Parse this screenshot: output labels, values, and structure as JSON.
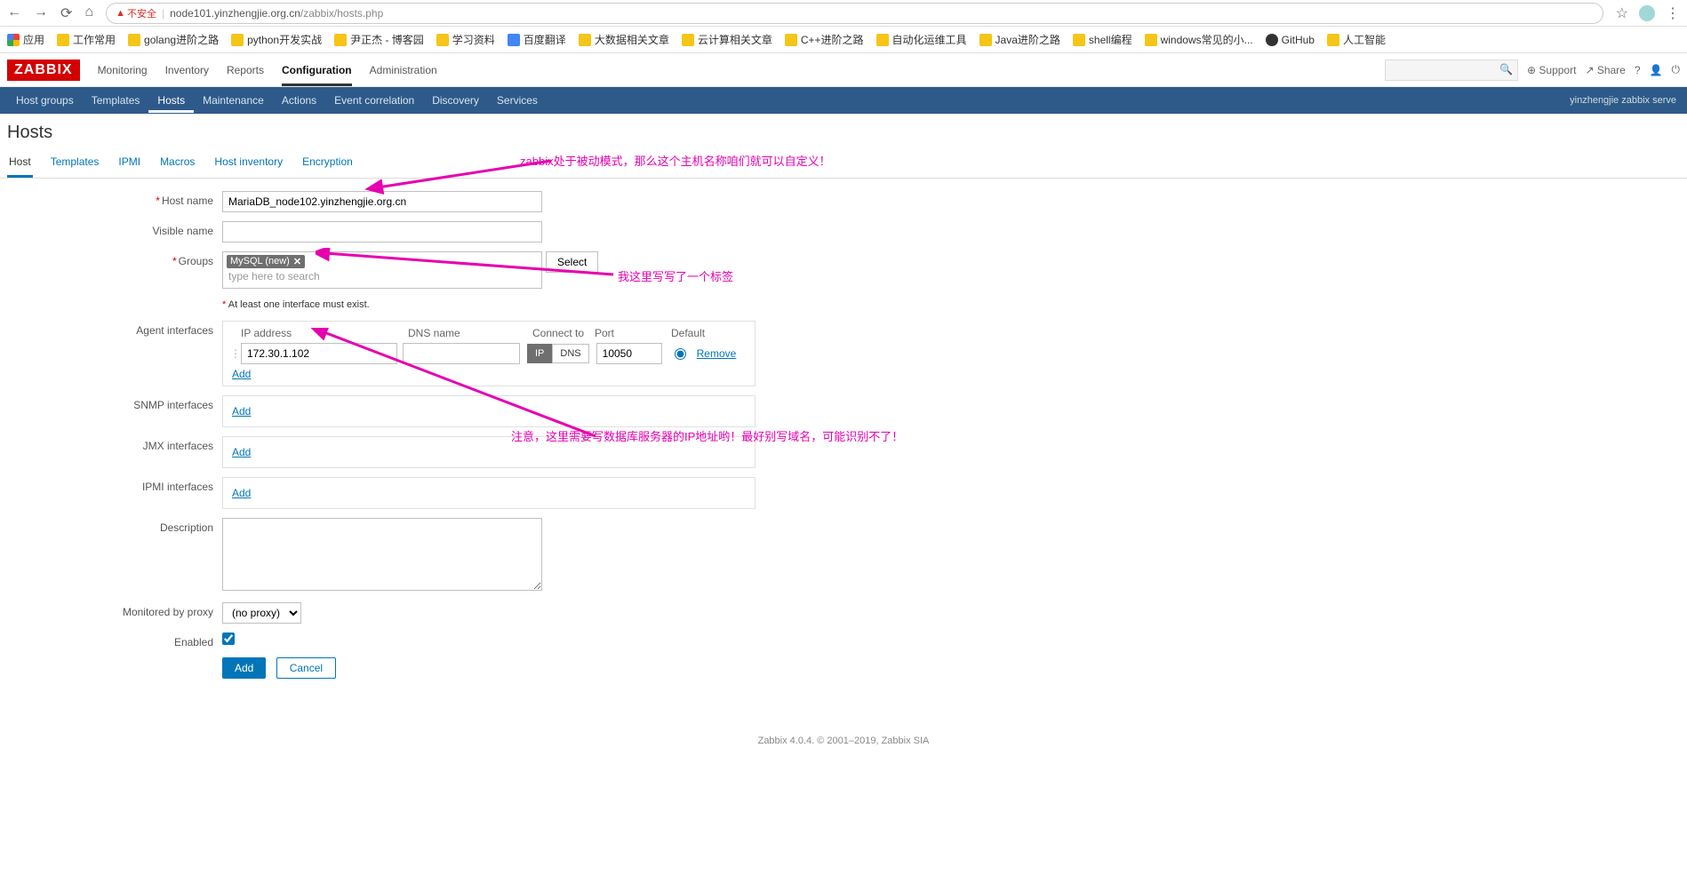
{
  "browser": {
    "url_warn": "不安全",
    "url_host": "node101.yinzhengjie.org.cn",
    "url_path": "/zabbix/hosts.php",
    "apps_label": "应用",
    "bookmarks": [
      {
        "label": "工作常用",
        "icon": "y"
      },
      {
        "label": "golang进阶之路",
        "icon": "y"
      },
      {
        "label": "python开发实战",
        "icon": "y"
      },
      {
        "label": "尹正杰 - 博客园",
        "icon": "y"
      },
      {
        "label": "学习资料",
        "icon": "y"
      },
      {
        "label": "百度翻译",
        "icon": "b"
      },
      {
        "label": "大数据相关文章",
        "icon": "y"
      },
      {
        "label": "云计算相关文章",
        "icon": "y"
      },
      {
        "label": "C++进阶之路",
        "icon": "y"
      },
      {
        "label": "自动化运维工具",
        "icon": "y"
      },
      {
        "label": "Java进阶之路",
        "icon": "y"
      },
      {
        "label": "shell编程",
        "icon": "y"
      },
      {
        "label": "windows常见的小...",
        "icon": "y"
      },
      {
        "label": "GitHub",
        "icon": "gh"
      },
      {
        "label": "人工智能",
        "icon": "y"
      }
    ]
  },
  "header": {
    "logo": "ZABBIX",
    "menu": [
      "Monitoring",
      "Inventory",
      "Reports",
      "Configuration",
      "Administration"
    ],
    "active_menu": "Configuration",
    "support": "Support",
    "share": "Share"
  },
  "subnav": {
    "items": [
      "Host groups",
      "Templates",
      "Hosts",
      "Maintenance",
      "Actions",
      "Event correlation",
      "Discovery",
      "Services"
    ],
    "active": "Hosts",
    "right": "yinzhengjie zabbix serve"
  },
  "page": {
    "title": "Hosts",
    "tabs": [
      "Host",
      "Templates",
      "IPMI",
      "Macros",
      "Host inventory",
      "Encryption"
    ],
    "active_tab": "Host"
  },
  "labels": {
    "host_name": "Host name",
    "visible_name": "Visible name",
    "groups": "Groups",
    "groups_placeholder": "type here to search",
    "select": "Select",
    "at_least_one": "At least one interface must exist.",
    "agent_interfaces": "Agent interfaces",
    "snmp_interfaces": "SNMP interfaces",
    "jmx_interfaces": "JMX interfaces",
    "ipmi_interfaces": "IPMI interfaces",
    "description": "Description",
    "monitored_by_proxy": "Monitored by proxy",
    "enabled": "Enabled",
    "add_btn": "Add",
    "cancel_btn": "Cancel",
    "add_link": "Add",
    "ip_address": "IP address",
    "dns_name": "DNS name",
    "connect_to": "Connect to",
    "port": "Port",
    "default": "Default",
    "remove": "Remove",
    "ip": "IP",
    "dns": "DNS"
  },
  "form": {
    "host_name_value": "MariaDB_node102.yinzhengjie.org.cn",
    "visible_name_value": "",
    "group_tag": "MySQL (new)",
    "agent_ip": "172.30.1.102",
    "agent_port": "10050",
    "proxy_value": "(no proxy)",
    "enabled_checked": true
  },
  "annotations": {
    "a1": "zabbix处于被动模式，那么这个主机名称咱们就可以自定义！",
    "a2": "我这里写写了一个标签",
    "a3": "注意，这里需要写数据库服务器的IP地址哟！最好别写域名，可能识别不了！"
  },
  "footer": "Zabbix 4.0.4. © 2001–2019, Zabbix SIA"
}
